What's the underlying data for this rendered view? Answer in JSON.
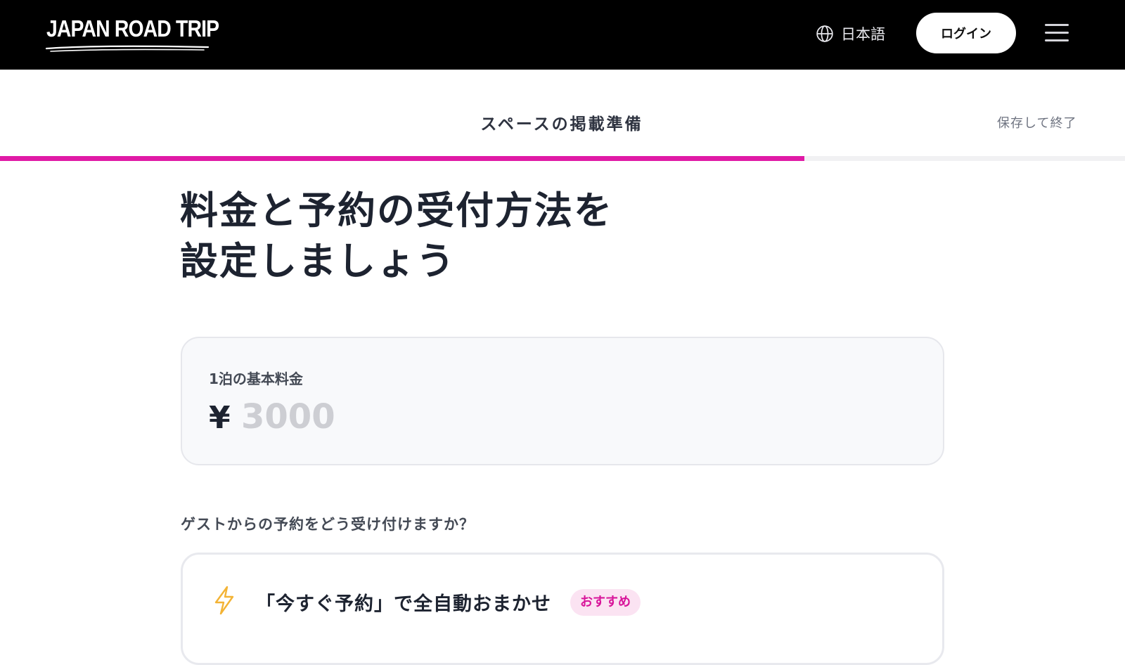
{
  "header": {
    "logo_text": "JAPAN ROAD TRIP",
    "language_label": "日本語",
    "login_label": "ログイン"
  },
  "subheader": {
    "title": "スペースの掲載準備",
    "save_exit_label": "保存して終了",
    "progress_percent": 71.5
  },
  "main": {
    "title_line1": "料金と予約の受付方法を",
    "title_line2": "設定しましょう",
    "price": {
      "label": "1泊の基本料金",
      "currency_symbol": "¥",
      "value": "",
      "placeholder": "3000"
    },
    "booking_question": "ゲストからの予約をどう受け付けますか？",
    "options": [
      {
        "title": "「今すぐ予約」で全自動おまかせ",
        "badge": "おすすめ",
        "icon": "lightning-icon"
      }
    ]
  },
  "colors": {
    "accent": "#e01aa6",
    "badge_bg": "#fbe3f2",
    "bolt": "#f3b335"
  }
}
